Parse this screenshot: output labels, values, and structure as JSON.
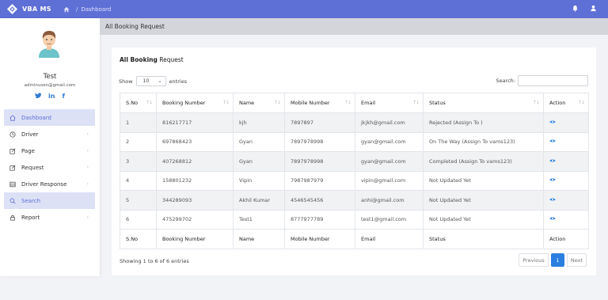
{
  "app": {
    "name": "VBA MS"
  },
  "breadcrumb": {
    "page": "Dashboard"
  },
  "user": {
    "name": "Test",
    "email": "adminusen@gmail.com",
    "socials": [
      "twitter",
      "in",
      "f"
    ]
  },
  "sidebar": {
    "items": [
      {
        "label": "Dashboard",
        "icon": "home-icon",
        "active": true
      },
      {
        "label": "Driver",
        "icon": "clock-icon",
        "has_children": true
      },
      {
        "label": "Page",
        "icon": "edit-icon",
        "has_children": true
      },
      {
        "label": "Request",
        "icon": "edit-icon",
        "has_children": true
      },
      {
        "label": "Driver Response",
        "icon": "list-icon",
        "has_children": true
      },
      {
        "label": "Search",
        "icon": "search-icon",
        "active": true
      },
      {
        "label": "Report",
        "icon": "lock-icon",
        "has_children": true
      }
    ]
  },
  "content_header": "All Booking Request",
  "card": {
    "title_bold": "All Booking",
    "title_rest": " Request",
    "show_label": "Show",
    "entries_value": "10",
    "entries_label": "entries",
    "search_label": "Search:",
    "search_value": ""
  },
  "table": {
    "headers": [
      "S.No",
      "Booking Number",
      "Name",
      "Mobile Number",
      "Email",
      "Status",
      "Action"
    ],
    "rows": [
      [
        "1",
        "816217717",
        "kjh",
        "7897897",
        "jkjkh@gmail.com",
        "Rejected (Assign To )"
      ],
      [
        "2",
        "697868423",
        "Gyan",
        "7897978998",
        "gyan@gmail.com",
        "On The Way (Assign To vams123)"
      ],
      [
        "3",
        "407268812",
        "Gyan",
        "7897978998",
        "gyan@gmail.com",
        "Completed (Assign To vams123)"
      ],
      [
        "4",
        "158801232",
        "Vipin",
        "7987987979",
        "vipin@gmail.com",
        "Not Updated Yet"
      ],
      [
        "5",
        "344289093",
        "Akhil Kumar",
        "4546545456",
        "anhi@gmail.com",
        "Not Updated Yet"
      ],
      [
        "6",
        "475299702",
        "Test1",
        "8777977789",
        "test1@gmail.com",
        "Not Updated Yet"
      ]
    ]
  },
  "footer": {
    "info": "Showing 1 to 6 of 6 entries",
    "prev": "Previous",
    "page": "1",
    "next": "Next"
  },
  "colors": {
    "primary": "#5e6fd6",
    "accent": "#2a7fe0"
  }
}
